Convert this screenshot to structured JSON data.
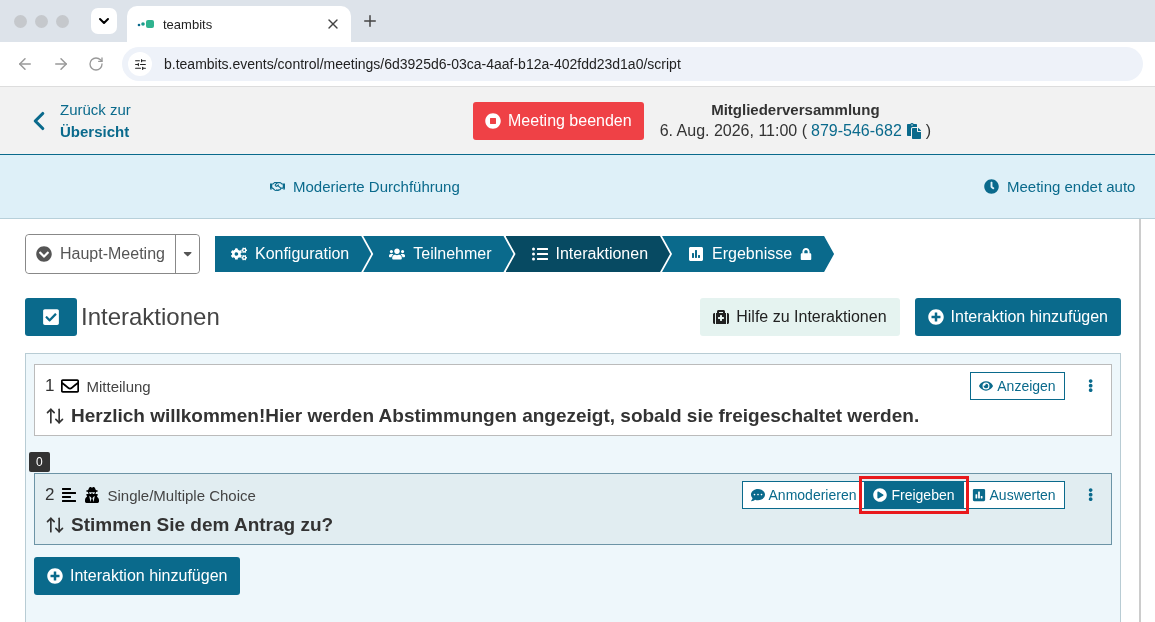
{
  "browser": {
    "tab_title": "teambits",
    "url": "b.teambits.events/control/meetings/6d3925d6-03ca-4aaf-b12a-402fdd23d1a0/script"
  },
  "header": {
    "back_link": [
      "Zurück zur",
      "Übersicht"
    ],
    "end_button": "Meeting beenden",
    "meeting_title": "Mitgliederversammlung",
    "meeting_date": "6. Aug. 2026, 11:00 (",
    "meeting_code": "879-546-682",
    "close_paren": ")"
  },
  "info_bar": [
    {
      "kind": "handshake",
      "label": "Moderierte Durchführung"
    },
    {
      "kind": "clock",
      "label": "Meeting endet auto"
    }
  ],
  "meeting_select": "Haupt-Meeting",
  "steps": [
    {
      "kind": "config",
      "label": "Konfiguration",
      "selected": false,
      "locked": false
    },
    {
      "kind": "people",
      "label": "Teilnehmer",
      "selected": false,
      "locked": false
    },
    {
      "kind": "list",
      "label": "Interaktionen",
      "selected": true,
      "locked": false
    },
    {
      "kind": "results",
      "label": "Ergebnisse",
      "selected": false,
      "locked": true
    }
  ],
  "page_title": "Interaktionen",
  "help_button": "Hilfe zu Interaktionen",
  "add_button": "Interaktion hinzufügen",
  "interactions": [
    {
      "number": "1",
      "kind": "message",
      "type_label": "Mitteilung",
      "anonymous": false,
      "selected": false,
      "text": "Herzlich willkommen!Hier werden Abstimmungen angezeigt, sobald sie freigeschaltet werden.",
      "actions": [
        {
          "kind": "show",
          "label": "Anzeigen",
          "highlighted": false
        }
      ]
    },
    {
      "number": "2",
      "kind": "choice",
      "type_label": "Single/Multiple Choice",
      "anonymous": true,
      "selected": true,
      "badge": "0",
      "text": "Stimmen Sie dem Antrag zu?",
      "actions": [
        {
          "kind": "moderate",
          "label": "Anmoderieren",
          "highlighted": false
        },
        {
          "kind": "release",
          "label": "Freigeben",
          "highlighted": true
        },
        {
          "kind": "evaluate",
          "label": "Auswerten",
          "highlighted": false
        }
      ]
    }
  ],
  "bottom_add_button": "Interaktion hinzufügen"
}
